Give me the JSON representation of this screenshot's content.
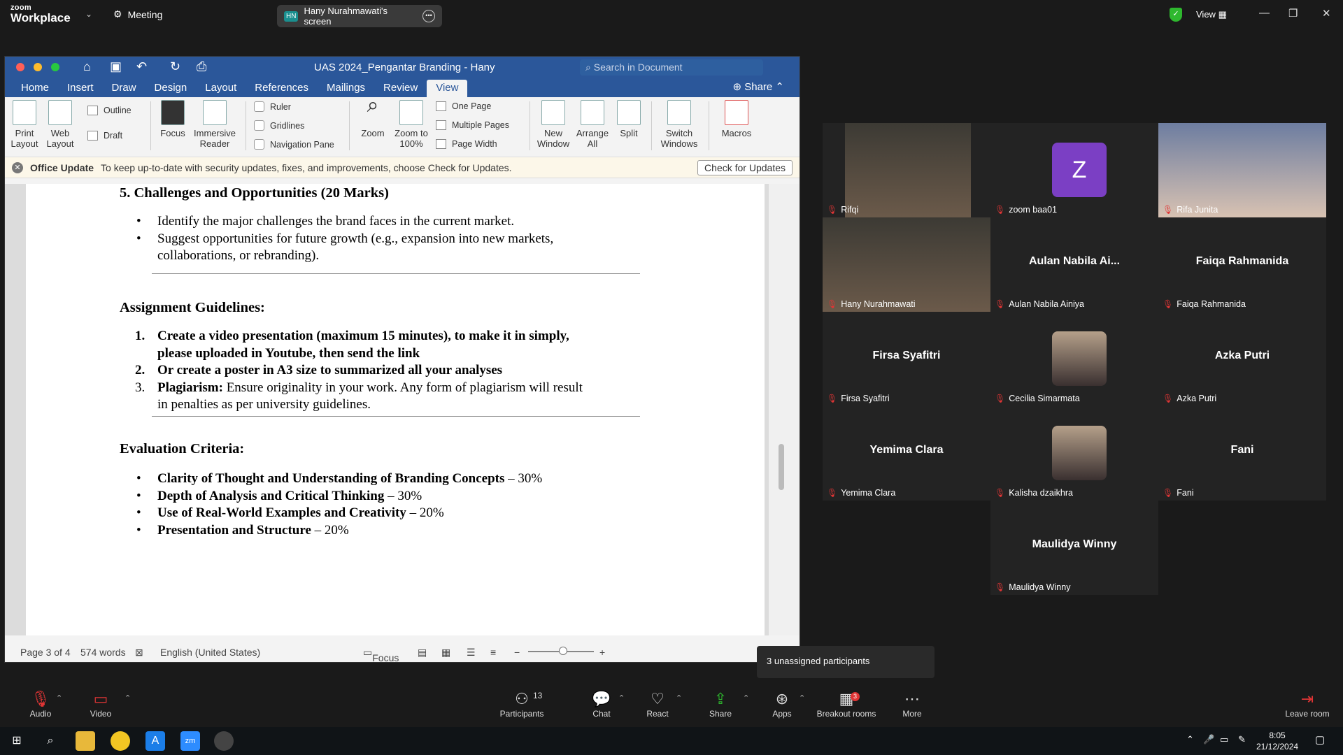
{
  "zoom": {
    "brand_small": "zoom",
    "brand": "Workplace",
    "meeting_label": "Meeting",
    "screen_initials": "HN",
    "screen_label": "Hany Nurahmawati's screen",
    "view_label": "View",
    "accent_color": "#23d96b"
  },
  "word": {
    "doc_title": "UAS 2024_Pengantar Branding - Hany",
    "search_placeholder": "Search in Document",
    "tabs": [
      "Home",
      "Insert",
      "Draw",
      "Design",
      "Layout",
      "References",
      "Mailings",
      "Review",
      "View"
    ],
    "active_tab": "View",
    "share_label": "Share",
    "ribbon": {
      "print_layout": "Print Layout",
      "web_layout": "Web Layout",
      "outline": "Outline",
      "draft": "Draft",
      "focus": "Focus",
      "immersive_reader": "Immersive Reader",
      "ruler": "Ruler",
      "gridlines": "Gridlines",
      "navigation_pane": "Navigation Pane",
      "zoom": "Zoom",
      "zoom_100": "Zoom to 100%",
      "one_page": "One Page",
      "multiple_pages": "Multiple Pages",
      "page_width": "Page Width",
      "new_window": "New Window",
      "arrange_all": "Arrange All",
      "split": "Split",
      "switch_windows": "Switch Windows",
      "macros": "Macros"
    },
    "update_bar": {
      "title": "Office Update",
      "message": "To keep up-to-date with security updates, fixes, and improvements, choose Check for Updates.",
      "button": "Check for Updates"
    },
    "document": {
      "heading1": "5. Challenges and Opportunities (20 Marks)",
      "bullets1": [
        "Identify the major challenges the brand faces in the current market.",
        "Suggest opportunities for future growth (e.g., expansion into new markets, collaborations, or rebranding)."
      ],
      "heading2": "Assignment Guidelines:",
      "guide1": "Create a video presentation (maximum 15 minutes), to make it in simply, please uploaded in Youtube, then send the link",
      "guide2": "Or create a poster in A3 size to summarized all your analyses",
      "guide3_bold": "Plagiarism:",
      "guide3_rest": " Ensure originality in your work. Any form of plagiarism will result in penalties as per university guidelines.",
      "heading3": "Evaluation Criteria:",
      "criteria": [
        {
          "bold": "Clarity of Thought and Understanding of Branding Concepts",
          "rest": " – 30%"
        },
        {
          "bold": "Depth of Analysis and Critical Thinking",
          "rest": " – 30%"
        },
        {
          "bold": "Use of Real-World Examples and Creativity",
          "rest": " – 20%"
        },
        {
          "bold": "Presentation and Structure",
          "rest": " – 20%"
        }
      ]
    },
    "status": {
      "page": "Page 3 of 4",
      "words": "574 words",
      "language": "English (United States)",
      "focus": "Focus"
    }
  },
  "gallery": [
    {
      "label": "Rifqi",
      "name": "",
      "kind": "video"
    },
    {
      "label": "zoom baa01",
      "name": "",
      "kind": "avatar",
      "initial": "Z",
      "color": "#7b3fc4"
    },
    {
      "label": "Rifa Junita",
      "name": "",
      "kind": "video"
    },
    {
      "label": "Hany Nurahmawati",
      "name": "",
      "kind": "video"
    },
    {
      "label": "Aulan Nabila Ainiya",
      "name": "Aulan  Nabila  Ai...",
      "kind": "name"
    },
    {
      "label": "Faiqa Rahmanida",
      "name": "Faiqa Rahmanida",
      "kind": "name"
    },
    {
      "label": "Firsa Syafitri",
      "name": "Firsa Syafitri",
      "kind": "name"
    },
    {
      "label": "Cecilia Simarmata",
      "name": "",
      "kind": "photo"
    },
    {
      "label": "Azka Putri",
      "name": "Azka Putri",
      "kind": "name"
    },
    {
      "label": "Yemima Clara",
      "name": "Yemima Clara",
      "kind": "name"
    },
    {
      "label": "Kalisha dzaikhra",
      "name": "",
      "kind": "photo"
    },
    {
      "label": "Fani",
      "name": "Fani",
      "kind": "name"
    },
    {
      "label": "Maulidya Winny",
      "name": "Maulidya Winny",
      "kind": "name"
    }
  ],
  "tooltip": "3 unassigned participants",
  "toolbar": {
    "audio": "Audio",
    "video": "Video",
    "participants": "Participants",
    "participants_count": "13",
    "chat": "Chat",
    "react": "React",
    "share": "Share",
    "apps": "Apps",
    "breakout": "Breakout rooms",
    "breakout_badge": "3",
    "more": "More",
    "leave": "Leave room"
  },
  "taskbar": {
    "time": "8:05",
    "date": "21/12/2024"
  }
}
